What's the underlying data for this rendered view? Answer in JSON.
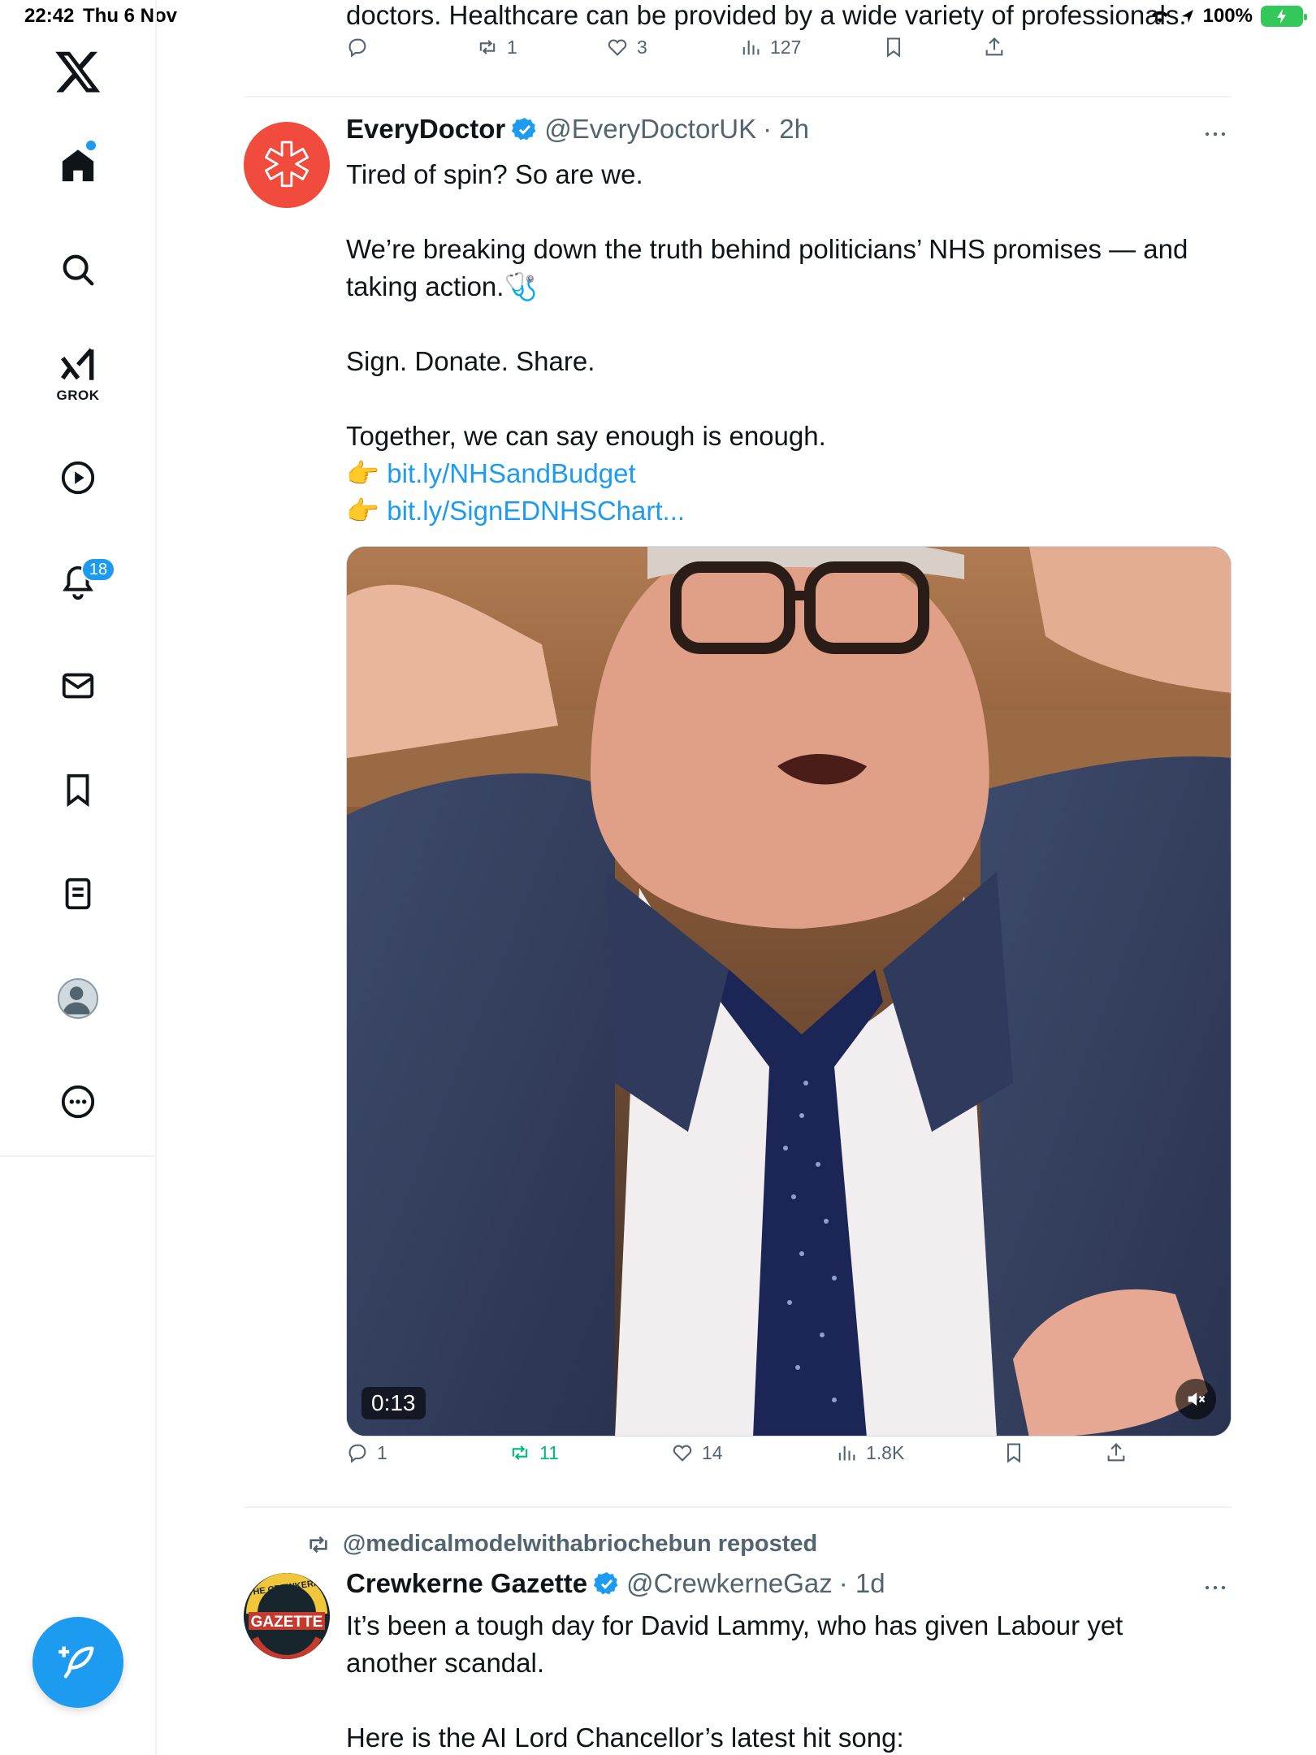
{
  "status_bar": {
    "time": "22:42",
    "date": "Thu 6 Nov",
    "battery": "100%"
  },
  "sidebar": {
    "items": [
      {
        "name": "home",
        "icon": "home-icon"
      },
      {
        "name": "explore",
        "icon": "search-icon"
      },
      {
        "name": "grok",
        "icon": "grok-icon",
        "label": "GROK"
      },
      {
        "name": "video",
        "icon": "play-icon"
      },
      {
        "name": "notifications",
        "icon": "bell-icon",
        "badge": "18"
      },
      {
        "name": "messages",
        "icon": "mail-icon"
      },
      {
        "name": "bookmarks",
        "icon": "bookmark-icon"
      },
      {
        "name": "lists",
        "icon": "list-icon"
      },
      {
        "name": "profile",
        "icon": "avatar-icon"
      },
      {
        "name": "more",
        "icon": "more-circle-icon"
      }
    ],
    "accent": "#1d9bf0"
  },
  "feed": {
    "previous_tweet": {
      "text_fragment": "doctors. Healthcare can be provided by a wide variety of professionals.",
      "replies": "",
      "reposts": "1",
      "likes": "3",
      "views": "127"
    },
    "tweets": [
      {
        "display_name": "EveryDoctor",
        "handle": "@EveryDoctorUK",
        "time": "· 2h",
        "lines": [
          "Tired of spin? So are we.",
          "",
          "We’re breaking down the truth behind politicians’ NHS promises — and taking action.🩺",
          "",
          "Sign. Donate. Share.",
          "",
          "Together, we can say enough is enough."
        ],
        "links": [
          {
            "emoji": "👉",
            "text": "bit.ly/NHSandBudget"
          },
          {
            "emoji": "👉",
            "text": "bit.ly/SignEDNHSChart..."
          }
        ],
        "video_duration": "0:13",
        "replies": "1",
        "reposts": "11",
        "likes": "14",
        "views": "1.8K"
      },
      {
        "reposted_by": "@medicalmodelwithabriochebun reposted",
        "display_name": "Crewkerne Gazette",
        "handle": "@CrewkerneGaz",
        "time": "· 1d",
        "avatar_text_top": "THE CREWKERNE",
        "avatar_text_main": "GAZETTE",
        "lines": [
          "It’s been a tough day for David Lammy, who has given Labour yet another scandal.",
          "",
          "Here is the AI Lord Chancellor’s latest hit song:"
        ]
      }
    ]
  },
  "colors": {
    "text": "#0f1419",
    "secondary": "#536471",
    "link": "#1d9bf0",
    "repost_active": "#00ba7c",
    "everydoctor_brand": "#f04b3d"
  }
}
